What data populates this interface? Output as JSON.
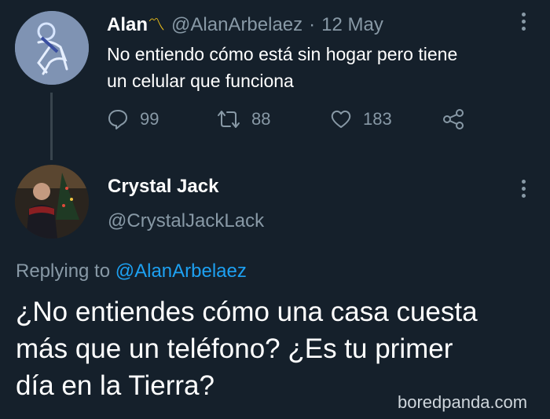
{
  "tweet": {
    "name": "Alan",
    "emoji": "〽",
    "handle": "@AlanArbelaez",
    "sep": "·",
    "date": "12 May",
    "text_line1": "No entiendo cómo está sin hogar pero tiene",
    "text_line2": "un celular que funciona",
    "replies": "99",
    "retweets": "88",
    "likes": "183"
  },
  "reply": {
    "name": "Crystal Jack",
    "handle": "@CrystalJackLack",
    "replying_prefix": "Replying to",
    "replying_handle": "@AlanArbelaez",
    "line1": "¿No entiendes cómo una casa cuesta",
    "line2": "más que un teléfono? ¿Es tu primer",
    "line3": "día en la Tierra?"
  },
  "watermark": "boredpanda.com",
  "icons": {
    "reply": "speech-bubble-icon",
    "retweet": "retweet-icon",
    "like": "heart-icon",
    "share": "share-icon",
    "more": "more-vertical-icon"
  },
  "colors": {
    "background": "#15202b",
    "muted": "#8899a6",
    "link": "#1da1f2",
    "text": "#ffffff"
  }
}
